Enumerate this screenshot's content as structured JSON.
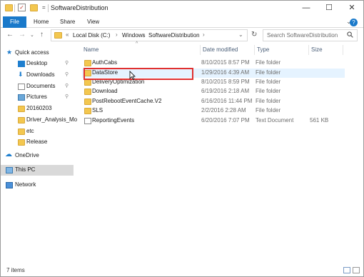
{
  "window": {
    "title": "SoftwareDistribution"
  },
  "ribbon": {
    "tabs": [
      "File",
      "Home",
      "Share",
      "View"
    ]
  },
  "address": {
    "crumbs": [
      "Local Disk (C:)",
      "Windows",
      "SoftwareDistribution"
    ],
    "search_placeholder": "Search SoftwareDistribution"
  },
  "nav": {
    "quick_access": "Quick access",
    "items": [
      "Desktop",
      "Downloads",
      "Documents",
      "Pictures",
      "20160203",
      "Driver_Analysis_Mo",
      "etc",
      "Release"
    ],
    "onedrive": "OneDrive",
    "thispc": "This PC",
    "network": "Network"
  },
  "columns": {
    "name": "Name",
    "date": "Date modified",
    "type": "Type",
    "size": "Size"
  },
  "files": [
    {
      "name": "AuthCabs",
      "date": "8/10/2015 8:57 PM",
      "type": "File folder",
      "size": ""
    },
    {
      "name": "DataStore",
      "date": "1/29/2016 4:39 AM",
      "type": "File folder",
      "size": ""
    },
    {
      "name": "DeliveryOptimization",
      "date": "8/10/2015 8:59 PM",
      "type": "File folder",
      "size": ""
    },
    {
      "name": "Download",
      "date": "6/19/2016 2:18 AM",
      "type": "File folder",
      "size": ""
    },
    {
      "name": "PostRebootEventCache.V2",
      "date": "6/16/2016 11:44 PM",
      "type": "File folder",
      "size": ""
    },
    {
      "name": "SLS",
      "date": "2/2/2016 2:28 AM",
      "type": "File folder",
      "size": ""
    },
    {
      "name": "ReportingEvents",
      "date": "6/20/2016 7:07 PM",
      "type": "Text Document",
      "size": "561 KB"
    }
  ],
  "status": {
    "items": "7 items"
  },
  "colors": {
    "accent": "#1979ca",
    "folder": "#f3c74f",
    "highlight": "#e03030"
  }
}
